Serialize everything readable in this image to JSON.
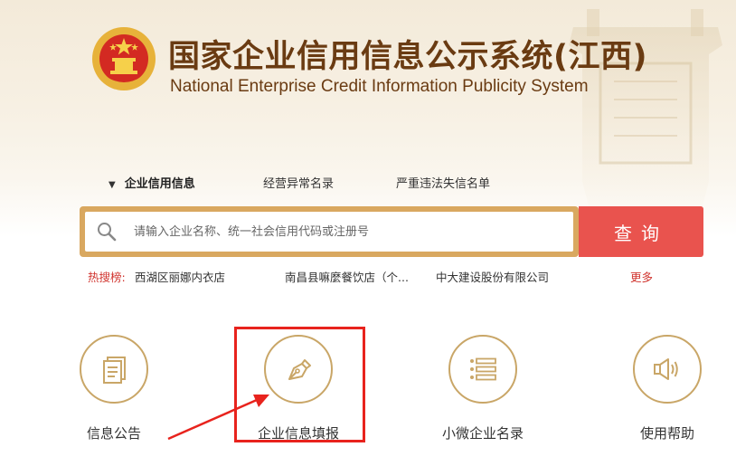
{
  "header": {
    "title_cn": "国家企业信用信息公示系统(江西)",
    "title_en": "National Enterprise Credit Information Publicity System"
  },
  "tabs": [
    {
      "label": "企业信用信息",
      "active": true
    },
    {
      "label": "经营异常名录",
      "active": false
    },
    {
      "label": "严重违法失信名单",
      "active": false
    }
  ],
  "search": {
    "placeholder": "请输入企业名称、统一社会信用代码或注册号",
    "value": "",
    "button_label": "查询"
  },
  "hot_search": {
    "label": "热搜榜:",
    "items": [
      "西湖区丽娜内衣店",
      "南昌县嘛麼餐饮店（个...",
      "中大建设股份有限公司"
    ],
    "more_label": "更多"
  },
  "features": [
    {
      "label": "信息公告",
      "icon": "document-icon"
    },
    {
      "label": "企业信息填报",
      "icon": "pen-nib-icon",
      "highlighted": true
    },
    {
      "label": "小微企业名录",
      "icon": "list-icon"
    },
    {
      "label": "使用帮助",
      "icon": "speaker-icon"
    }
  ],
  "colors": {
    "brand_brown": "#6a3b12",
    "gold": "#c9a667",
    "search_border": "#d9a860",
    "search_button": "#e9534e",
    "hot_red": "#d0332d",
    "highlight_red": "#e8231d"
  }
}
